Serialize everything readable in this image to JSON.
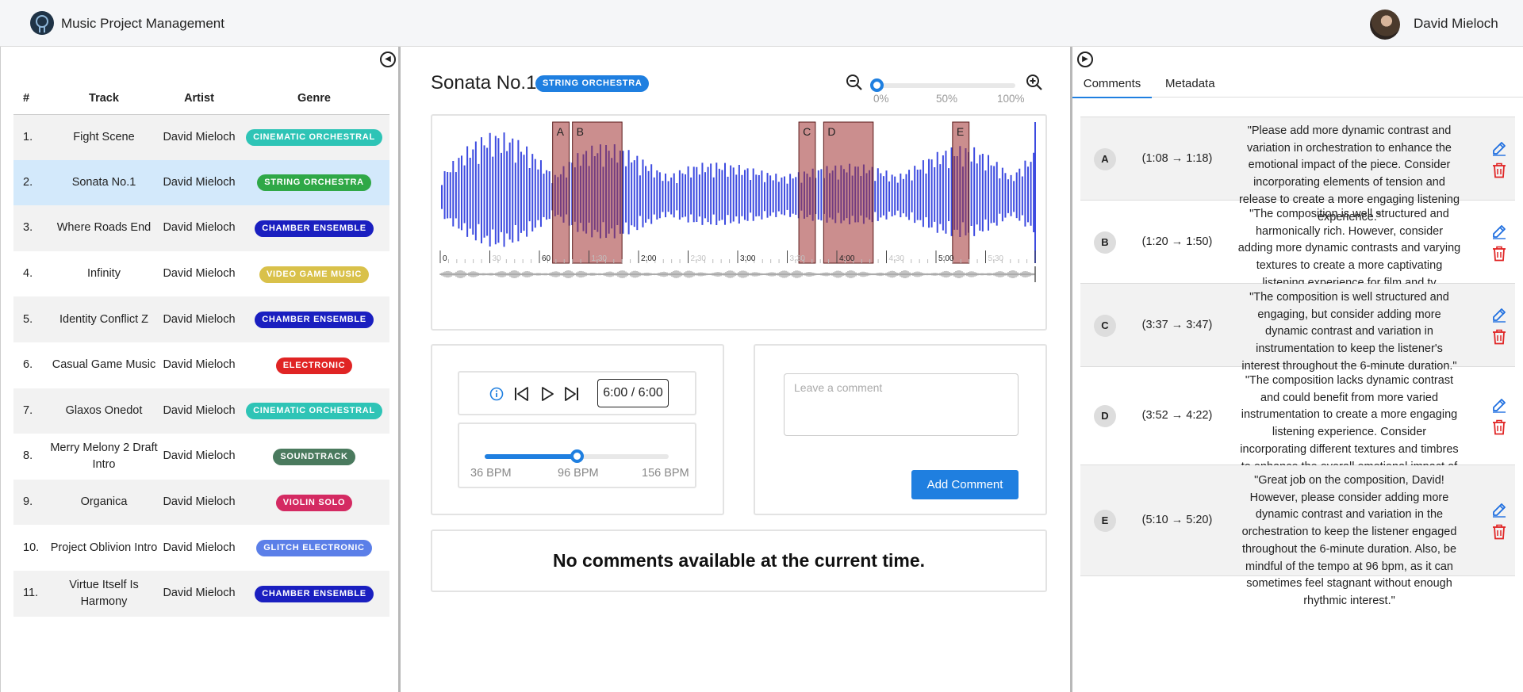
{
  "app": {
    "title": "Music Project Management",
    "user_name": "David Mieloch"
  },
  "tracks": {
    "headers": {
      "num": "#",
      "track": "Track",
      "artist": "Artist",
      "genre": "Genre"
    },
    "rows": [
      {
        "num": "1.",
        "track": "Fight Scene",
        "artist": "David Mieloch",
        "genre": "CINEMATIC ORCHESTRAL",
        "color": "#2ec4b6"
      },
      {
        "num": "2.",
        "track": "Sonata No.1",
        "artist": "David Mieloch",
        "genre": "STRING ORCHESTRA",
        "color": "#2fa847",
        "selected": true
      },
      {
        "num": "3.",
        "track": "Where Roads End",
        "artist": "David Mieloch",
        "genre": "CHAMBER ENSEMBLE",
        "color": "#1a1fc0"
      },
      {
        "num": "4.",
        "track": "Infinity",
        "artist": "David Mieloch",
        "genre": "VIDEO GAME MUSIC",
        "color": "#d9c14a"
      },
      {
        "num": "5.",
        "track": "Identity Conflict Z",
        "artist": "David Mieloch",
        "genre": "CHAMBER ENSEMBLE",
        "color": "#1a1fc0"
      },
      {
        "num": "6.",
        "track": "Casual Game Music",
        "artist": "David Mieloch",
        "genre": "ELECTRONIC",
        "color": "#e02424"
      },
      {
        "num": "7.",
        "track": "Glaxos Onedot",
        "artist": "David Mieloch",
        "genre": "CINEMATIC ORCHESTRAL",
        "color": "#2ec4b6"
      },
      {
        "num": "8.",
        "track": "Merry Melony 2 Draft Intro",
        "artist": "David Mieloch",
        "genre": "SOUNDTRACK",
        "color": "#4a7a5e"
      },
      {
        "num": "9.",
        "track": "Organica",
        "artist": "David Mieloch",
        "genre": "VIOLIN SOLO",
        "color": "#d42a62"
      },
      {
        "num": "10.",
        "track": "Project Oblivion Intro",
        "artist": "David Mieloch",
        "genre": "GLITCH ELECTRONIC",
        "color": "#5b7fe8"
      },
      {
        "num": "11.",
        "track": "Virtue Itself Is Harmony",
        "artist": "David Mieloch",
        "genre": "CHAMBER ENSEMBLE",
        "color": "#1a1fc0"
      }
    ]
  },
  "player": {
    "title": "Sonata No.1",
    "genre": "STRING ORCHESTRA",
    "genre_color": "#1f7fe0",
    "zoom": {
      "value": 0,
      "labels": [
        "0%",
        "50%",
        "100%"
      ]
    },
    "time_display": "6:00 / 6:00",
    "duration_seconds": 360,
    "timeline_labels": [
      "0",
      "30",
      "60",
      "1:30",
      "2:00",
      "2:30",
      "3:00",
      "3:30",
      "4:00",
      "4:30",
      "5:00",
      "5:30"
    ],
    "regions": [
      {
        "label": "A",
        "start": 68,
        "end": 78
      },
      {
        "label": "B",
        "start": 80,
        "end": 110
      },
      {
        "label": "C",
        "start": 217,
        "end": 227
      },
      {
        "label": "D",
        "start": 232,
        "end": 262
      },
      {
        "label": "E",
        "start": 310,
        "end": 320
      }
    ],
    "tempo": {
      "min_label": "36 BPM",
      "value_label": "96 BPM",
      "max_label": "156 BPM",
      "min": 36,
      "max": 156,
      "value": 96
    },
    "comment_placeholder": "Leave a comment",
    "add_comment_label": "Add Comment",
    "no_comments_text": "No comments available at the current time."
  },
  "sidebar": {
    "tabs": [
      "Comments",
      "Metadata"
    ],
    "comments": [
      {
        "label": "A",
        "range": "(1:08 → 1:18)",
        "text": "\"Please add more dynamic contrast and variation in orchestration to enhance the emotional impact of the piece. Consider incorporating elements of tension and release to create a more engaging listening experience.\""
      },
      {
        "label": "B",
        "range": "(1:20 → 1:50)",
        "text": "\"The composition is well structured and harmonically rich. However, consider adding more dynamic contrasts and varying textures to create a more captivating listening experience for film and tv placements.\""
      },
      {
        "label": "C",
        "range": "(3:37 → 3:47)",
        "text": "\"The composition is well structured and engaging, but consider adding more dynamic contrast and variation in instrumentation to keep the listener's interest throughout the 6-minute duration.\""
      },
      {
        "label": "D",
        "range": "(3:52 → 4:22)",
        "text": "\"The composition lacks dynamic contrast and could benefit from more varied instrumentation to create a more engaging listening experience. Consider incorporating different textures and timbres to enhance the overall emotional impact of the piece.\""
      },
      {
        "label": "E",
        "range": "(5:10 → 5:20)",
        "text": "\"Great job on the composition, David! However, please consider adding more dynamic contrast and variation in the orchestration to keep the listener engaged throughout the 6-minute duration. Also, be mindful of the tempo at 96 bpm, as it can sometimes feel stagnant without enough rhythmic interest.\""
      }
    ]
  }
}
